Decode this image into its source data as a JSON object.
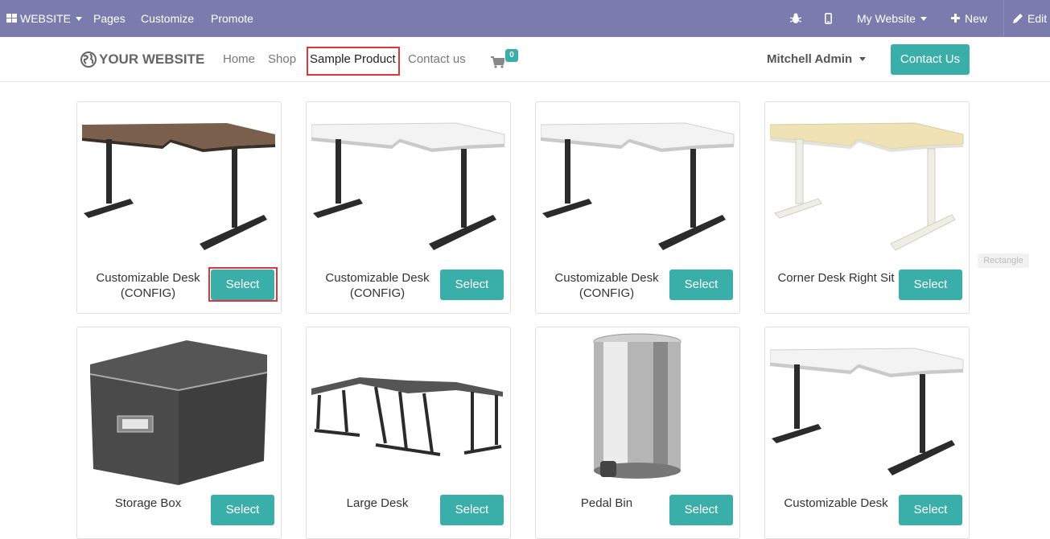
{
  "admin_bar": {
    "apps_label": "WEBSITE",
    "menu": [
      "Pages",
      "Customize",
      "Promote"
    ],
    "website_label": "My Website",
    "new_label": "New",
    "edit_label": "Edit"
  },
  "header": {
    "logo_text": "YOUR WEBSITE",
    "nav": [
      "Home",
      "Shop",
      "Sample Product",
      "Contact us"
    ],
    "cart_count": "0",
    "user_name": "Mitchell Admin",
    "contact_button": "Contact Us"
  },
  "products": [
    {
      "name": "Customizable Desk (CONFIG)",
      "button": "Select",
      "image": "desk-dark-icon"
    },
    {
      "name": "Customizable Desk (CONFIG)",
      "button": "Select",
      "image": "desk-white-icon"
    },
    {
      "name": "Customizable Desk (CONFIG)",
      "button": "Select",
      "image": "desk-white-icon"
    },
    {
      "name": "Corner Desk Right Sit",
      "button": "Select",
      "image": "desk-birch-icon"
    },
    {
      "name": "Storage Box",
      "button": "Select",
      "image": "storage-box-icon"
    },
    {
      "name": "Large Desk",
      "button": "Select",
      "image": "large-desk-icon"
    },
    {
      "name": "Pedal Bin",
      "button": "Select",
      "image": "pedal-bin-icon"
    },
    {
      "name": "Customizable Desk",
      "button": "Select",
      "image": "desk-white-icon"
    }
  ],
  "overlay_tag": "Rectangle",
  "colors": {
    "admin_bar": "#7c7bad",
    "accent": "#3aafa9",
    "highlight": "#d9363e"
  }
}
